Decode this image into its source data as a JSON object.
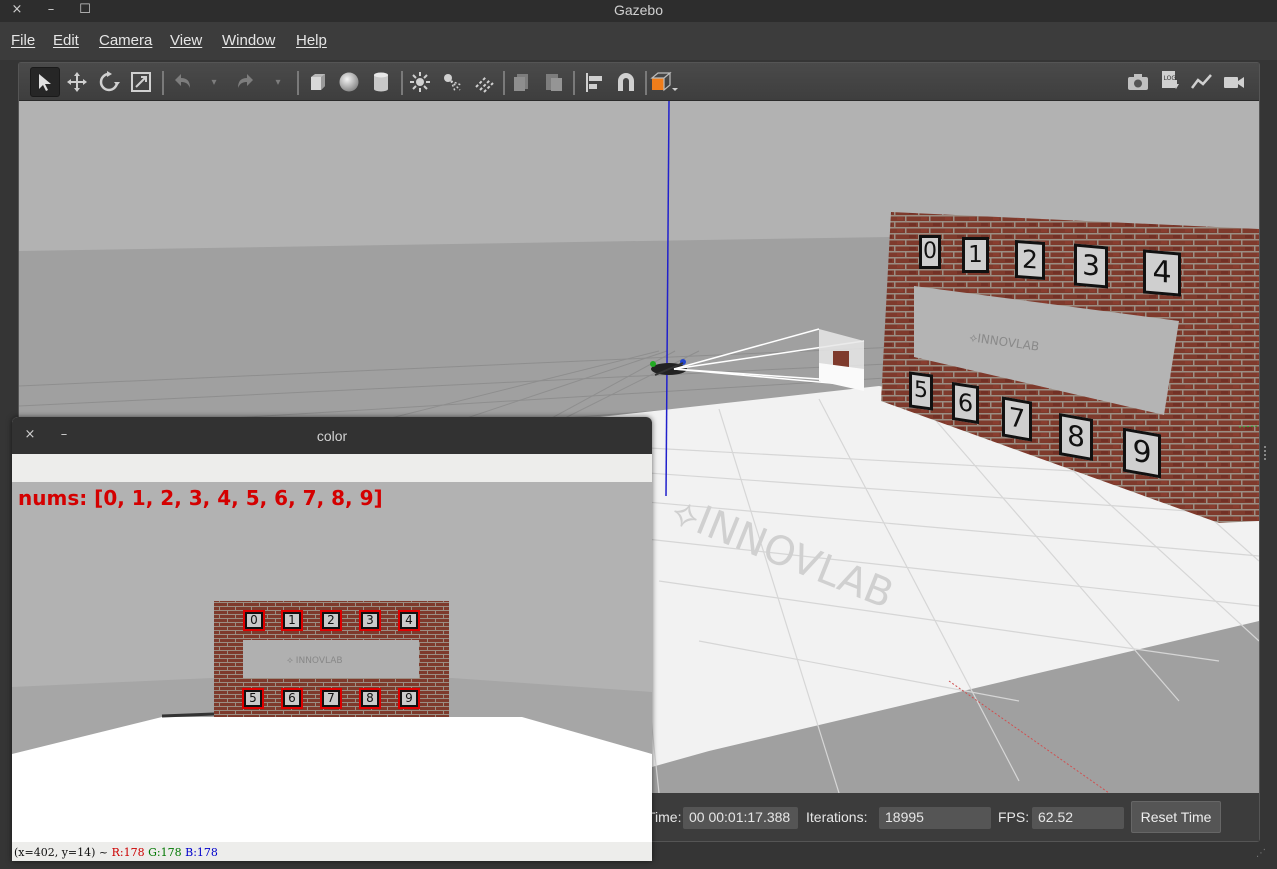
{
  "window": {
    "title": "Gazebo",
    "close": "×",
    "minimize": "–",
    "maximize": "☐"
  },
  "menu": [
    "File",
    "Edit",
    "Camera",
    "View",
    "Window",
    "Help"
  ],
  "toolbar_icons": [
    "select-arrow-icon",
    "translate-icon",
    "rotate-icon",
    "scale-icon",
    "undo-icon",
    "redo-icon",
    "box-icon",
    "sphere-icon",
    "cylinder-icon",
    "sun-light-icon",
    "spot-light-icon",
    "directional-light-icon",
    "copy-icon",
    "paste-icon",
    "align-icon",
    "snap-magnet-icon",
    "view-angle-icon",
    "screenshot-icon",
    "log-icon",
    "plot-icon",
    "record-video-icon"
  ],
  "wall": {
    "top_numbers": [
      "0",
      "1",
      "2",
      "3",
      "4"
    ],
    "bottom_numbers": [
      "5",
      "6",
      "7",
      "8",
      "9"
    ]
  },
  "status": {
    "time_label": "Time:",
    "time_value": "00 00:01:17.388",
    "iterations_label": "Iterations:",
    "iterations_value": "18995",
    "fps_label": "FPS:",
    "fps_value": "62.52",
    "reset_button": "Reset Time"
  },
  "color_window": {
    "title": "color",
    "close": "×",
    "minimize": "–",
    "nums_text": "nums: [0, 1, 2, 3, 4, 5, 6, 7, 8, 9]",
    "status_coords": "(x=402, y=14) ~",
    "status_r": "R:178",
    "status_g": "G:178",
    "status_b": "B:178",
    "status_r_color": "#cc0000",
    "status_g_color": "#007700",
    "status_b_color": "#0000cc"
  }
}
